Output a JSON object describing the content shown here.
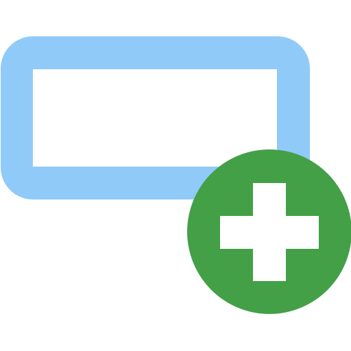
{
  "icon": {
    "name": "add-textbox-icon",
    "parts": [
      {
        "name": "textbox-outline-icon",
        "color": "#90CAF9"
      },
      {
        "name": "add-badge-icon",
        "color": "#43A047"
      },
      {
        "name": "plus-icon",
        "color": "#FFFFFF"
      }
    ]
  }
}
